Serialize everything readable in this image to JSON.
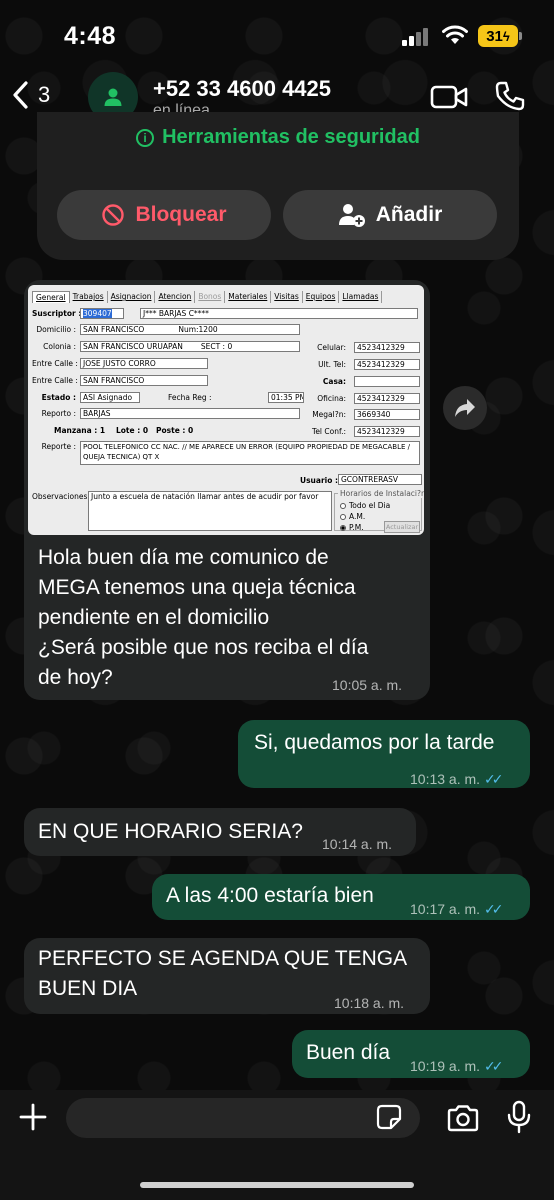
{
  "status_bar": {
    "time": "4:48",
    "battery": "31"
  },
  "header": {
    "back_count": "3",
    "contact_name": "+52 33 4600 4425",
    "contact_status": "en línea"
  },
  "security": {
    "title": "Herramientas de seguridad",
    "block_label": "Bloquear",
    "add_label": "Añadir"
  },
  "app_screenshot": {
    "tabs": [
      "General",
      "Trabajos",
      "Asignacion",
      "Atencion",
      "Bonos",
      "Materiales",
      "Visitas",
      "Equipos",
      "Llamadas"
    ],
    "labels": {
      "suscriptor": "Suscriptor :",
      "domicilio": "Domicilio :",
      "colonia": "Colonia :",
      "entre_calle_1": "Entre Calle :",
      "entre_calle_2": "Entre Calle :",
      "estado": "Estado :",
      "fecha_reg": "Fecha Reg :",
      "reporto": "Reporto :",
      "manzana": "Manzana : 1",
      "lote": "Lote : 0",
      "poste": "Poste : 0",
      "reporte": "Reporte :",
      "usuario": "Usuario :",
      "observaciones": "Observaciones:",
      "celular": "Celular:",
      "ult_tel": "Ult. Tel:",
      "casa": "Casa:",
      "oficina": "Oficina:",
      "megal": "Megal?n:",
      "tel_conf": "Tel Conf.:",
      "horarios": "Horarios de Instalaci?n"
    },
    "values": {
      "suscriptor_id": "309407",
      "suscriptor_name": "J*** BARJAS C****",
      "domicilio": "SAN FRANCISCO",
      "num": "Num:1200",
      "colonia": "SAN FRANCISCO URUAPAN",
      "sect": "SECT : 0",
      "entre_calle_1": "JOSE JUSTO CORRO",
      "entre_calle_2": "SAN FRANCISCO",
      "estado": "ASI Asignado",
      "hora": "01:35 PM",
      "reporto": "BARJAS",
      "reporte": "POOL TELEFONICO CC NAC. // ME APARECE UN ERROR (EQUIPO PROPIEDAD DE MEGACABLE / QUEJA TECNICA) QT X",
      "usuario": "GCONTRERASV",
      "observaciones": "Junto a escuela de natación llamar antes de acudir por favor",
      "celular": "4523412329",
      "ult_tel": "4523412329",
      "casa": "",
      "oficina": "4523412329",
      "megal": "3669340",
      "tel_conf": "4523412329"
    },
    "radios": [
      "Todo el Dia",
      "A.M.",
      "P.M."
    ],
    "radio_selected": "P.M.",
    "update_button": "Actualizar"
  },
  "messages": [
    {
      "text": "Hola buen día me comunico de MEGA tenemos una queja técnica pendiente en el domicilio ¿Será posible que nos reciba el día de hoy?",
      "time": "10:05 a. m."
    },
    {
      "text": "Si, quedamos por la tarde",
      "time": "10:13 a. m."
    },
    {
      "text": "EN QUE HORARIO SERIA?",
      "time": "10:14 a. m."
    },
    {
      "text": "A las 4:00 estaría bien",
      "time": "10:17 a. m."
    },
    {
      "text": "PERFECTO SE AGENDA QUE TENGA BUEN DIA",
      "time": "10:18 a. m."
    },
    {
      "text": "Buen día",
      "time": "10:19 a. m."
    }
  ],
  "message_lines": {
    "m0": [
      "Hola buen día me comunico de",
      "MEGA tenemos una queja técnica",
      "pendiente en el domicilio",
      "¿Será posible que nos reciba el día",
      "de hoy?"
    ],
    "m4": [
      "PERFECTO SE AGENDA QUE TENGA",
      "BUEN DIA"
    ]
  },
  "colors": {
    "incoming_bubble": "#242626",
    "outgoing_bubble": "#144d37",
    "accent_green": "#21c063",
    "read_ticks": "#53bdeb",
    "block_red": "#ff5a6a",
    "battery_yellow": "#f5c518"
  },
  "icons": [
    "back-chevron-icon",
    "contact-avatar-icon",
    "video-call-icon",
    "phone-call-icon",
    "info-icon",
    "block-icon",
    "add-contact-icon",
    "forward-icon",
    "plus-icon",
    "sticker-icon",
    "camera-icon",
    "microphone-icon"
  ]
}
